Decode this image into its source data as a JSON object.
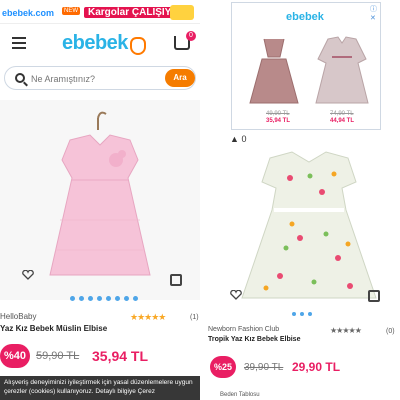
{
  "promo": {
    "brand": "ebebek.com",
    "tag": "NEW",
    "text": "Kargolar ÇALIŞIYOR!"
  },
  "header": {
    "logo": "ebebek",
    "cart_count": "0",
    "icons": [
      "menu-icon",
      "cart-icon"
    ]
  },
  "search": {
    "placeholder": "Ne Aramıştınız?",
    "button": "Ara"
  },
  "product_left": {
    "brand": "HelloBaby",
    "title": "Yaz Kız Bebek Müslin Elbise",
    "stars": "★★★★★",
    "reviews": "(1)",
    "discount": "%40",
    "old_price": "59,90 TL",
    "new_price": "35,94 TL",
    "image_color": "#f8c9dc"
  },
  "cookie": {
    "text": "Alışveriş deneyiminizi iyileştirmek için yasal düzenlemelere uygun çerezler (cookies) kullanıyoruz. Detaylı bilgiye Çerez"
  },
  "ad": {
    "logo": "ebebek",
    "close_label": "ⓘ ✕",
    "items": [
      {
        "old_price": "49,90 TL",
        "new_price": "35,94 TL",
        "color": "#b88a8a"
      },
      {
        "old_price": "74,90 TL",
        "new_price": "44,94 TL",
        "color": "#d7c7c9"
      }
    ]
  },
  "vote": {
    "arrow": "▲",
    "count": "0"
  },
  "product_right": {
    "brand": "Newborn Fashion Club",
    "title": "Tropik Yaz Kız Bebek Elbise",
    "stars": "★★★★★",
    "reviews": "(0)",
    "discount": "%25",
    "old_price": "39,90 TL",
    "new_price": "29,90 TL",
    "image_color": "#f3f3f3"
  },
  "size_table": {
    "label": "Beden Tablosu"
  }
}
